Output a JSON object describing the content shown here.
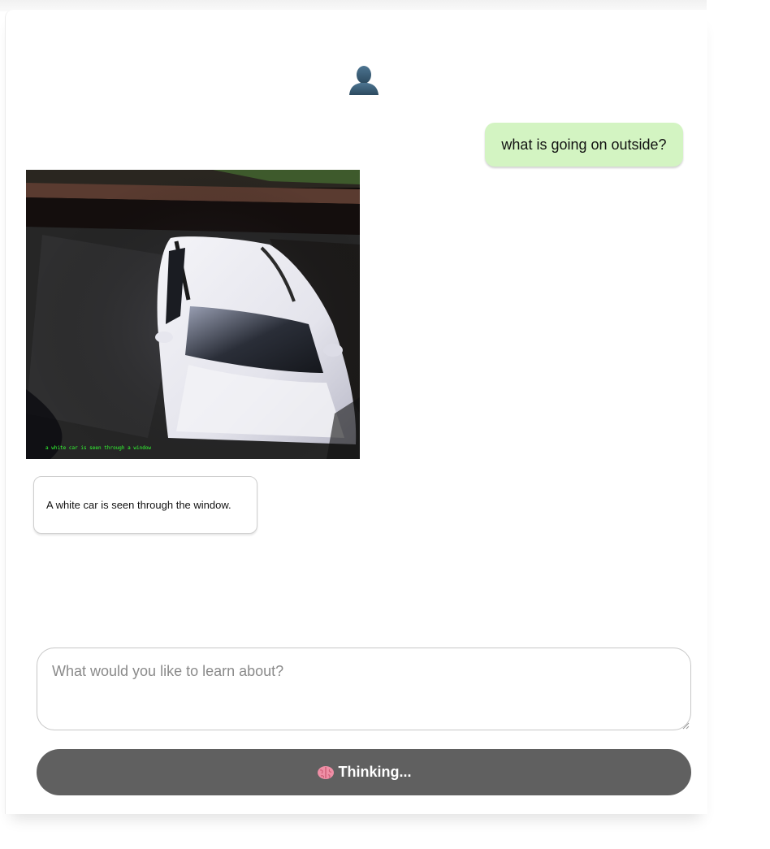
{
  "conversation": {
    "avatar_icon": "user-silhouette-icon",
    "user_message": "what is going on outside?",
    "camera_image": {
      "description_icon": "camera-frame-image",
      "overlay_caption": "a white car is seen through a window"
    },
    "bot_message": "A white car is seen through the window."
  },
  "composer": {
    "placeholder": "What would you like to learn about?",
    "value": ""
  },
  "submit_button": {
    "icon": "brain-icon",
    "label": "Thinking...",
    "color": "#606060"
  },
  "colors": {
    "user_bubble": "#d3f4c2",
    "avatar": "#3a5f78"
  }
}
